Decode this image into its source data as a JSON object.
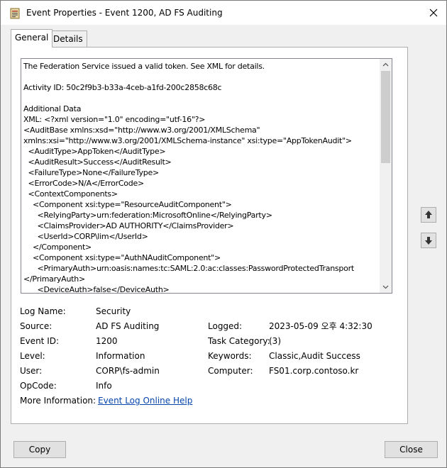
{
  "window": {
    "title": "Event Properties - Event 1200, AD FS Auditing",
    "icon": "event-viewer-icon"
  },
  "tabs": [
    {
      "label": "General",
      "active": true
    },
    {
      "label": "Details",
      "active": false
    }
  ],
  "description_lines": [
    "The Federation Service issued a valid token. See XML for details.",
    "",
    "Activity ID: 50c2f9b3-b33a-4ceb-a1fd-200c2858c68c",
    "",
    "Additional Data",
    "XML: <?xml version=\"1.0\" encoding=\"utf-16\"?>",
    "<AuditBase xmlns:xsd=\"http://www.w3.org/2001/XMLSchema\"",
    "xmlns:xsi=\"http://www.w3.org/2001/XMLSchema-instance\" xsi:type=\"AppTokenAudit\">",
    "  <AuditType>AppToken</AuditType>",
    "  <AuditResult>Success</AuditResult>",
    "  <FailureType>None</FailureType>",
    "  <ErrorCode>N/A</ErrorCode>",
    "  <ContextComponents>",
    "    <Component xsi:type=\"ResourceAuditComponent\">",
    "      <RelyingParty>urn:federation:MicrosoftOnline</RelyingParty>",
    "      <ClaimsProvider>AD AUTHORITY</ClaimsProvider>",
    "      <UserId>CORP\\lim</UserId>",
    "    </Component>",
    "    <Component xsi:type=\"AuthNAuditComponent\">",
    "      <PrimaryAuth>urn:oasis:names:tc:SAML:2.0:ac:classes:PasswordProtectedTransport",
    "</PrimaryAuth>",
    "      <DeviceAuth>false</DeviceAuth>"
  ],
  "properties": {
    "log_name_label": "Log Name:",
    "log_name": "Security",
    "source_label": "Source:",
    "source": "AD FS Auditing",
    "logged_label": "Logged:",
    "logged": "2023-05-09 오후 4:32:30",
    "event_id_label": "Event ID:",
    "event_id": "1200",
    "task_category_label": "Task Category:",
    "task_category": "(3)",
    "level_label": "Level:",
    "level": "Information",
    "keywords_label": "Keywords:",
    "keywords": "Classic,Audit Success",
    "user_label": "User:",
    "user": "CORP\\fs-admin",
    "computer_label": "Computer:",
    "computer": "FS01.corp.contoso.kr",
    "opcode_label": "OpCode:",
    "opcode": "Info",
    "more_info_label": "More Information:",
    "more_info_link": "Event Log Online Help"
  },
  "buttons": {
    "copy": "Copy",
    "close": "Close"
  },
  "colors": {
    "link": "#0645ad",
    "window_bg": "#f0f0f0",
    "panel_bg": "#ffffff"
  }
}
